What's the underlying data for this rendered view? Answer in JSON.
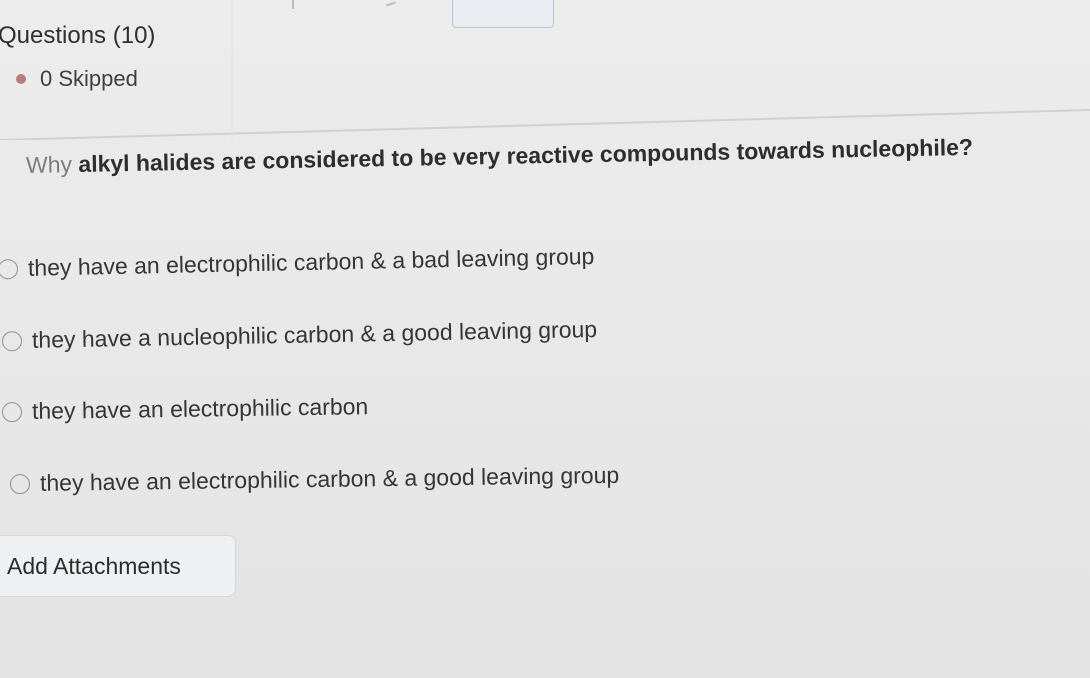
{
  "questions_header": {
    "title": "Questions (10)",
    "skipped_label": "0 Skipped",
    "skipped_dot_color": "#b67d7d"
  },
  "question": {
    "prefix": "Why",
    "text": " alkyl halides are considered to be very reactive compounds towards nucleophile?"
  },
  "options": [
    {
      "label": "they have an electrophilic carbon & a bad leaving group"
    },
    {
      "label": "they have a nucleophilic carbon & a good leaving group"
    },
    {
      "label": "they have an electrophilic carbon"
    },
    {
      "label": "they have an electrophilic carbon & a good leaving group"
    }
  ],
  "attachments_button": {
    "label": "Add Attachments"
  }
}
